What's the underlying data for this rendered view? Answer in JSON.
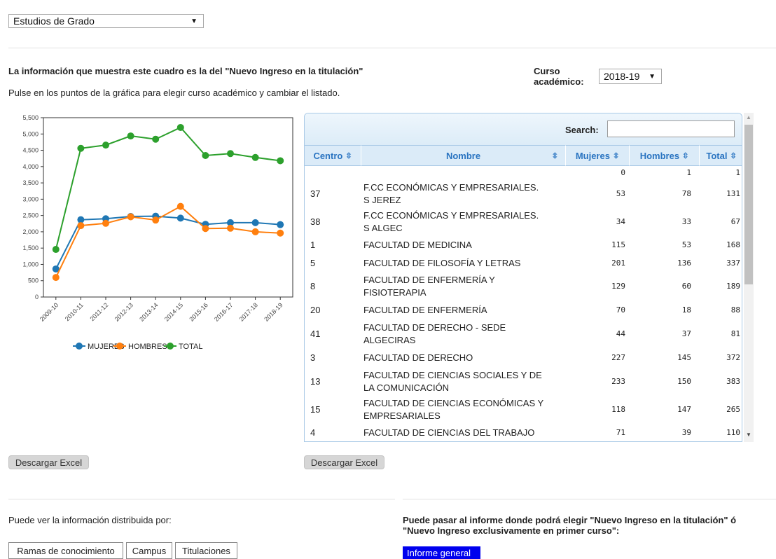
{
  "top_select": {
    "value": "Estudios de Grado"
  },
  "info": {
    "heading": "La información que muestra este cuadro es la del \"Nuevo Ingreso en la titulación\"",
    "instruction": "Pulse en los puntos de la gráfica para elegir curso académico y cambiar el listado."
  },
  "curso": {
    "label_line1": "Curso",
    "label_line2": "académico:",
    "value": "2018-19"
  },
  "chart_data": {
    "type": "line",
    "categories": [
      "2009-10",
      "2010-11",
      "2011-12",
      "2012-13",
      "2013-14",
      "2014-15",
      "2015-16",
      "2016-17",
      "2017-18",
      "2018-19"
    ],
    "series": [
      {
        "name": "MUJERES",
        "color": "#1f77b4",
        "values": [
          860,
          2370,
          2400,
          2470,
          2480,
          2420,
          2230,
          2280,
          2280,
          2220
        ]
      },
      {
        "name": "HOMBRES",
        "color": "#ff7f0e",
        "values": [
          600,
          2190,
          2260,
          2460,
          2360,
          2780,
          2100,
          2110,
          2000,
          1960
        ]
      },
      {
        "name": "TOTAL",
        "color": "#2ca02c",
        "values": [
          1460,
          4560,
          4660,
          4940,
          4840,
          5200,
          4340,
          4400,
          4280,
          4180
        ]
      }
    ],
    "y_ticks": [
      "0",
      "500",
      "1,000",
      "1,500",
      "2,000",
      "2,500",
      "3,000",
      "3,500",
      "4,000",
      "4,500",
      "5,000",
      "5,500"
    ],
    "ylim": [
      0,
      5500
    ]
  },
  "table": {
    "search_label": "Search:",
    "search_value": "",
    "headers": {
      "centro": "Centro",
      "nombre": "Nombre",
      "mujeres": "Mujeres",
      "hombres": "Hombres",
      "total": "Total"
    },
    "sort_icon": "⇳",
    "rows": [
      {
        "centro": "",
        "nombre1": "",
        "nombre2": "",
        "mujeres": "0",
        "hombres": "1",
        "total": "1"
      },
      {
        "centro": "37",
        "nombre1": "F.CC ECONÓMICAS Y EMPRESARIALES.",
        "nombre2": "S JEREZ",
        "mujeres": "53",
        "hombres": "78",
        "total": "131"
      },
      {
        "centro": "38",
        "nombre1": "F.CC ECONÓMICAS Y EMPRESARIALES.",
        "nombre2": "S ALGEC",
        "mujeres": "34",
        "hombres": "33",
        "total": "67"
      },
      {
        "centro": "1",
        "nombre1": "FACULTAD DE MEDICINA",
        "nombre2": "",
        "mujeres": "115",
        "hombres": "53",
        "total": "168"
      },
      {
        "centro": "5",
        "nombre1": "FACULTAD DE FILOSOFÍA Y LETRAS",
        "nombre2": "",
        "mujeres": "201",
        "hombres": "136",
        "total": "337"
      },
      {
        "centro": "8",
        "nombre1": "FACULTAD DE ENFERMERÍA Y",
        "nombre2": "FISIOTERAPIA",
        "mujeres": "129",
        "hombres": "60",
        "total": "189"
      },
      {
        "centro": "20",
        "nombre1": "FACULTAD DE ENFERMERÍA",
        "nombre2": "",
        "mujeres": "70",
        "hombres": "18",
        "total": "88"
      },
      {
        "centro": "41",
        "nombre1": "FACULTAD DE DERECHO - SEDE",
        "nombre2": "ALGECIRAS",
        "mujeres": "44",
        "hombres": "37",
        "total": "81"
      },
      {
        "centro": "3",
        "nombre1": "FACULTAD DE DERECHO",
        "nombre2": "",
        "mujeres": "227",
        "hombres": "145",
        "total": "372"
      },
      {
        "centro": "13",
        "nombre1": "FACULTAD DE CIENCIAS SOCIALES Y DE",
        "nombre2": "LA COMUNICACIÓN",
        "mujeres": "233",
        "hombres": "150",
        "total": "383"
      },
      {
        "centro": "15",
        "nombre1": "FACULTAD DE CIENCIAS ECONÓMICAS Y",
        "nombre2": "EMPRESARIALES",
        "mujeres": "118",
        "hombres": "147",
        "total": "265"
      },
      {
        "centro": "4",
        "nombre1": "FACULTAD DE CIENCIAS DEL TRABAJO",
        "nombre2": "",
        "mujeres": "71",
        "hombres": "39",
        "total": "110"
      }
    ]
  },
  "buttons": {
    "excel_left": "Descargar Excel",
    "excel_right": "Descargar Excel"
  },
  "bottom": {
    "left_text": "Puede ver la información distribuida por:",
    "tabs": [
      "Ramas de conocimiento",
      "Campus",
      "Titulaciones"
    ],
    "right_text1": "Puede pasar al informe donde podrá elegir \"Nuevo Ingreso en la titulación\" ó",
    "right_text2": "\"Nuevo Ingreso exclusivamente en primer curso\":",
    "informe_button": "Informe general"
  },
  "icons": {
    "dropdown": "▼",
    "scroll_up": "▲",
    "scroll_down": "▼"
  }
}
